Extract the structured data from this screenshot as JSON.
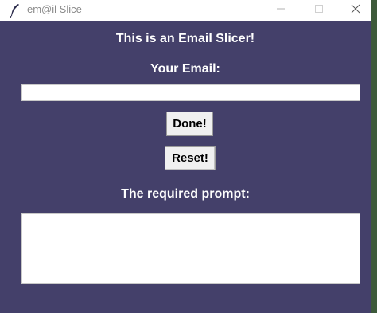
{
  "window": {
    "title": "em@il Slice",
    "background_color": "#44406a",
    "controls": {
      "minimize_icon": "minimize-icon",
      "maximize_icon": "maximize-icon",
      "close_icon": "close-icon"
    }
  },
  "main": {
    "heading": "This is an Email Slicer!",
    "email_label": "Your Email:",
    "email_value": "",
    "done_label": "Done!",
    "reset_label": "Reset!",
    "prompt_label": "The required prompt:",
    "prompt_value": ""
  }
}
